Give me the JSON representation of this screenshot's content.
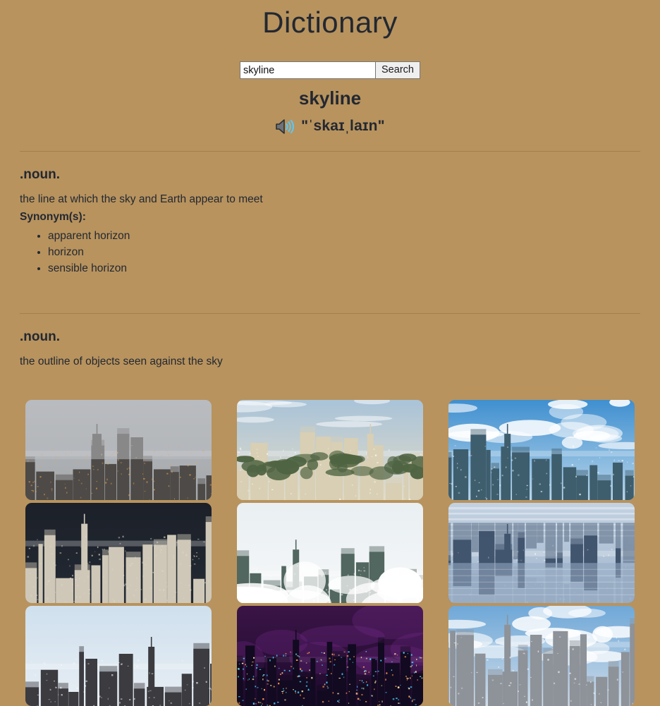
{
  "header": {
    "title": "Dictionary"
  },
  "search": {
    "value": "skyline",
    "placeholder": "",
    "button_label": "Search",
    "input_icon": "text-cursor-icon"
  },
  "entry": {
    "word": "skyline",
    "pronunciation": "\"ˈskaɪˌlaɪn\"",
    "audio_icon": "speaker-volume-icon"
  },
  "definitions": [
    {
      "part_of_speech": ".noun.",
      "text": "the line at which the sky and Earth appear to meet",
      "synonyms_label": "Synonym(s):",
      "synonyms": [
        "apparent horizon",
        "horizon",
        "sensible horizon"
      ]
    },
    {
      "part_of_speech": ".noun.",
      "text": "the outline of objects seen against the sky",
      "synonyms_label": "",
      "synonyms": []
    }
  ],
  "images": [
    {
      "alt": "foggy-city-skyline-shard-london",
      "sky_top": "#b9bcc0",
      "sky_bottom": "#9fa3a6",
      "city": "#4e4a47",
      "accent": "#e8a34a",
      "style": "fog"
    },
    {
      "alt": "moscow-state-university-skyline-dawn",
      "sky_top": "#a9c3d8",
      "sky_bottom": "#e3dcc8",
      "city": "#d8cfb4",
      "accent": "#4f6442",
      "style": "dawn"
    },
    {
      "alt": "philadelphia-skyline-blue-sky-clouds",
      "sky_top": "#3f8fd0",
      "sky_bottom": "#b9d6ea",
      "city": "#3e5e6e",
      "accent": "#ffffff",
      "style": "clouds"
    },
    {
      "alt": "dark-stormy-sky-dense-city-sao-paulo",
      "sky_top": "#1b2029",
      "sky_bottom": "#242a33",
      "city": "#cfc8b8",
      "accent": "#e0d8c4",
      "style": "storm"
    },
    {
      "alt": "skyscrapers-above-white-clouds",
      "sky_top": "#e9eff2",
      "sky_bottom": "#f6f8f9",
      "city": "#51675f",
      "accent": "#ffffff",
      "style": "aboveclouds"
    },
    {
      "alt": "manhattan-skyline-water-reflection",
      "sky_top": "#c3d2e2",
      "sky_bottom": "#9fb4cb",
      "city": "#42556e",
      "accent": "#d8e2ec",
      "style": "reflection"
    },
    {
      "alt": "nyc-skyline-empire-state-building-daylight",
      "sky_top": "#cfe0ee",
      "sky_bottom": "#e8eef4",
      "city": "#3b3b40",
      "accent": "#6e7277",
      "style": "daylight"
    },
    {
      "alt": "shanghai-skyline-night-neon-purple",
      "sky_top": "#3a1446",
      "sky_bottom": "#1d0a2c",
      "city": "#120a20",
      "accent": "#44d2ff",
      "style": "night"
    },
    {
      "alt": "aerial-manhattan-skyline-midtown",
      "sky_top": "#6fa8d8",
      "sky_bottom": "#cfdce8",
      "city": "#8e9299",
      "accent": "#ffffff",
      "style": "aerial"
    }
  ]
}
